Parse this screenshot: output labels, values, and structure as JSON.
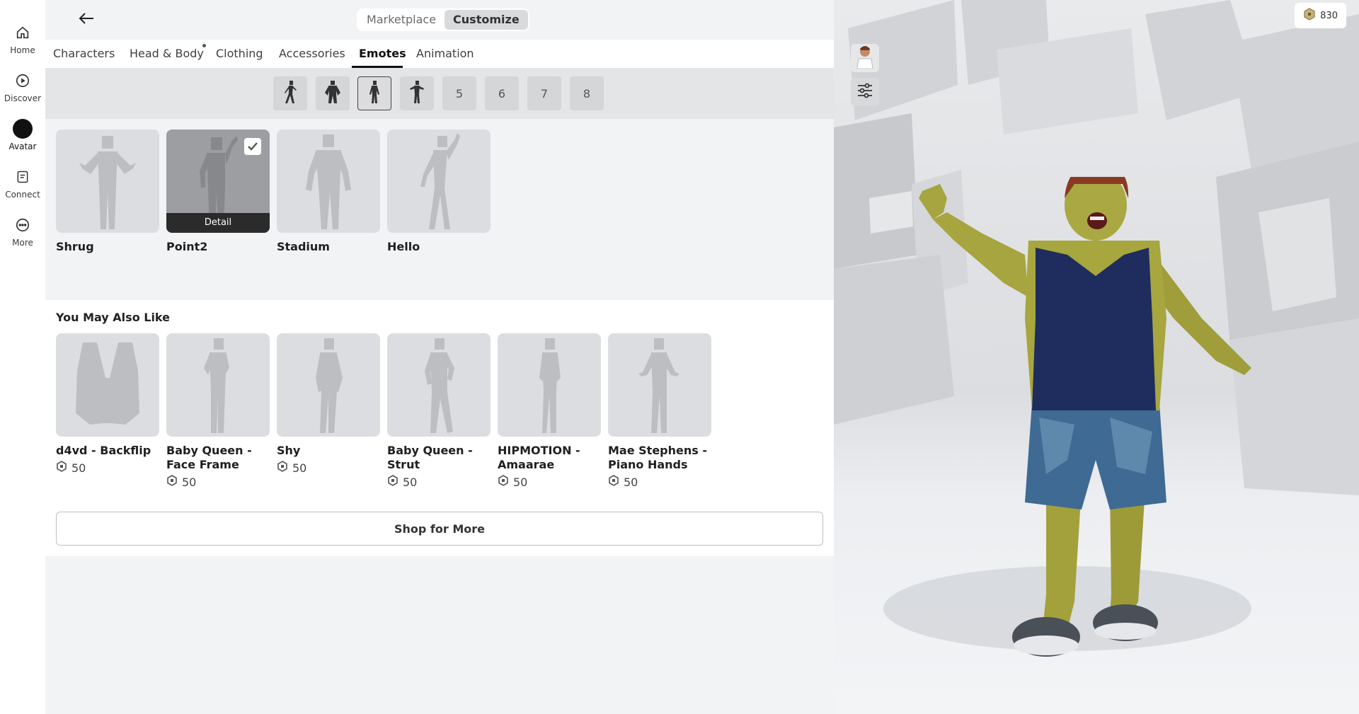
{
  "nav": {
    "items": [
      {
        "label": "Home",
        "icon": "home-icon"
      },
      {
        "label": "Discover",
        "icon": "play-icon"
      },
      {
        "label": "Avatar",
        "icon": "avatar-icon"
      },
      {
        "label": "Connect",
        "icon": "chat-icon"
      },
      {
        "label": "More",
        "icon": "more-icon"
      }
    ]
  },
  "topbar": {
    "segments": [
      "Marketplace",
      "Customize"
    ],
    "active_segment": "Customize"
  },
  "tabs": [
    "Characters",
    "Head & Body",
    "Clothing",
    "Accessories",
    "Emotes",
    "Animation"
  ],
  "active_tab": "Emotes",
  "slots": [
    "",
    "",
    "",
    "",
    "5",
    "6",
    "7",
    "8"
  ],
  "selected_slot": 3,
  "emotes": [
    {
      "name": "Shrug"
    },
    {
      "name": "Point2",
      "overlay": "Detail",
      "equipped": true
    },
    {
      "name": "Stadium"
    },
    {
      "name": "Hello"
    }
  ],
  "recommendations": {
    "title": "You May Also Like",
    "items": [
      {
        "name": "d4vd - Backflip",
        "price": "50"
      },
      {
        "name": "Baby Queen - Face Frame",
        "price": "50"
      },
      {
        "name": "Shy",
        "price": "50"
      },
      {
        "name": "Baby Queen - Strut",
        "price": "50"
      },
      {
        "name": "HIPMOTION - Amaarae",
        "price": "50"
      },
      {
        "name": "Mae Stephens - Piano Hands",
        "price": "50"
      }
    ],
    "shop_label": "Shop for More"
  },
  "balance": "830",
  "colors": {
    "accent": "#111111",
    "panel": "#f2f3f5",
    "card": "#dcdde0",
    "skin": "#a7a63f",
    "tank": "#1e2c5c"
  }
}
